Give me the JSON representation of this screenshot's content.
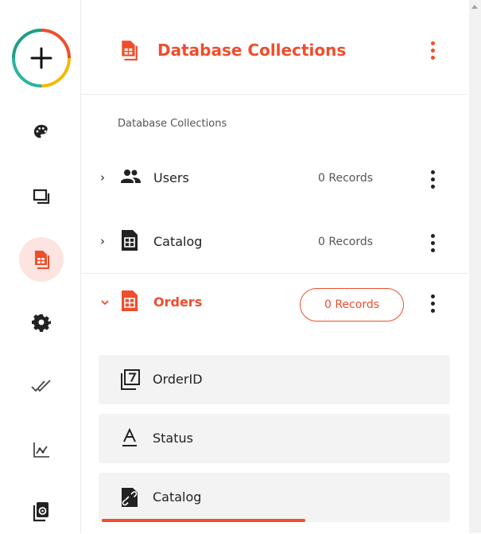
{
  "colors": {
    "accent": "#ef4d2c",
    "text": "#222222",
    "muted": "#555555",
    "active_bg": "#fde4e0",
    "field_bg": "#f3f3f3"
  },
  "rail": {
    "items": [
      {
        "icon": "palette-icon"
      },
      {
        "icon": "layers-icon"
      },
      {
        "icon": "database-icon",
        "active": true
      },
      {
        "icon": "gear-icon"
      },
      {
        "icon": "double-check-icon"
      },
      {
        "icon": "analytics-icon"
      },
      {
        "icon": "copy-settings-icon"
      }
    ]
  },
  "header": {
    "title": "Database Collections",
    "icon": "database-icon"
  },
  "section_label": "Database Collections",
  "collections": [
    {
      "name": "Users",
      "records": "0 Records",
      "icon": "users-icon",
      "expanded": false
    },
    {
      "name": "Catalog",
      "records": "0 Records",
      "icon": "table-icon",
      "expanded": false
    },
    {
      "name": "Orders",
      "records": "0 Records",
      "icon": "table-icon",
      "expanded": true
    }
  ],
  "fields": [
    {
      "name": "OrderID",
      "icon": "number-icon"
    },
    {
      "name": "Status",
      "icon": "text-icon"
    },
    {
      "name": "Catalog",
      "icon": "reference-icon"
    }
  ]
}
